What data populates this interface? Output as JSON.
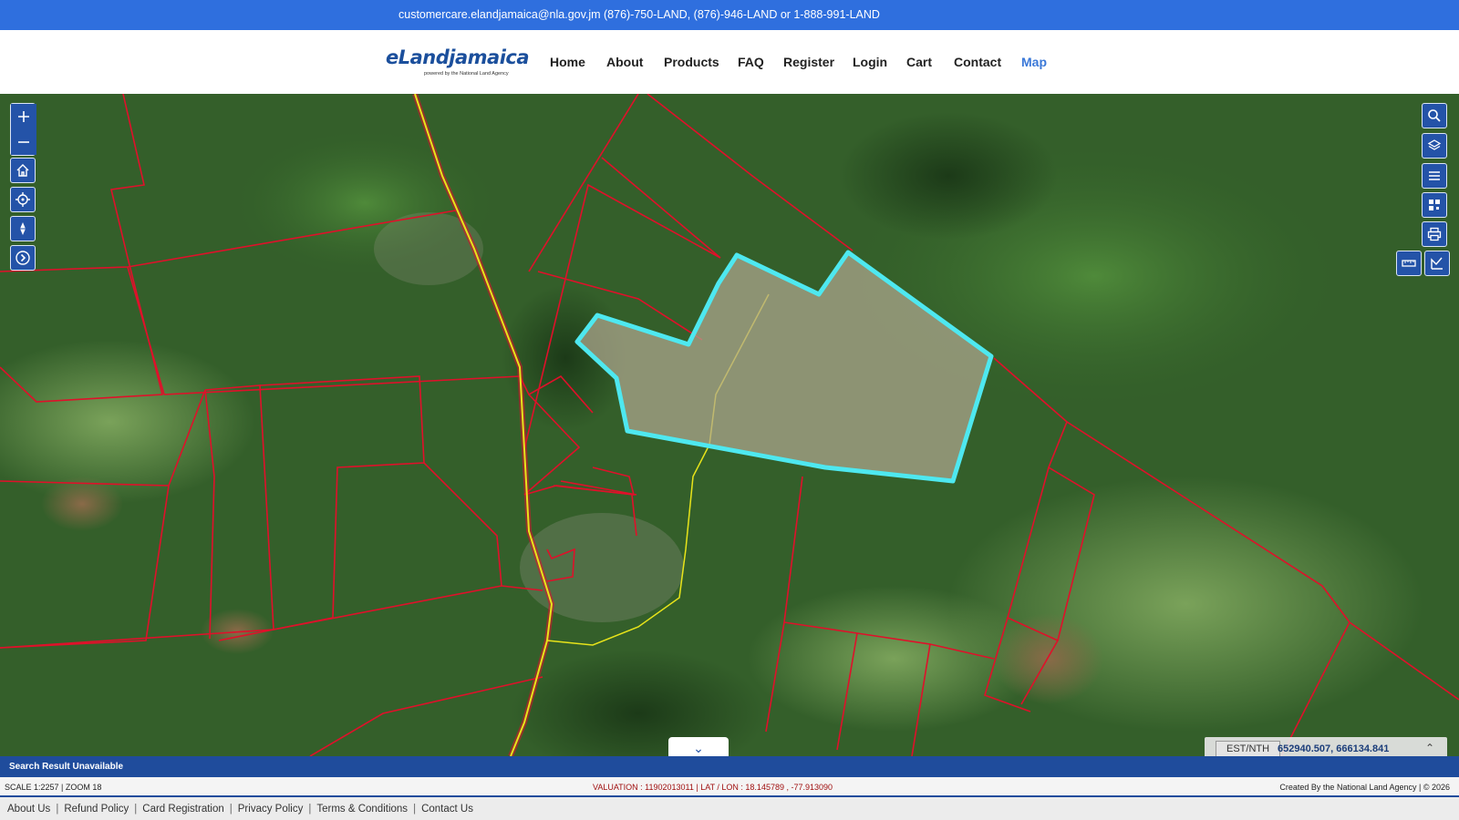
{
  "topbar": {
    "email": "customercare.elandjamaica@nla.gov.jm",
    "phones": "(876)-750-LAND, (876)-946-LAND or 1-888-991-LAND"
  },
  "logo": {
    "brand": "eLandjamaica",
    "tagline": "powered by the National Land Agency"
  },
  "nav": {
    "items": [
      {
        "label": "Home"
      },
      {
        "label": "About"
      },
      {
        "label": "Products"
      },
      {
        "label": "FAQ"
      },
      {
        "label": "Register"
      },
      {
        "label": "Login"
      },
      {
        "label": "Cart"
      },
      {
        "label": "Contact"
      },
      {
        "label": "Map"
      }
    ],
    "active": "Map"
  },
  "map": {
    "left_controls": [
      "zoom-in-icon",
      "zoom-out-icon",
      "home-icon",
      "locate-icon",
      "compass-icon",
      "next-icon"
    ],
    "right_controls": [
      "search-icon",
      "layers-icon",
      "list-icon",
      "qr-icon",
      "print-icon",
      "measure-icon",
      "draw-icon"
    ],
    "coord_label": "EST/NTH",
    "coord_value": "652940.507, 666134.841",
    "colors": {
      "parcel_lines": "#e0102a",
      "selected_parcel": "#4ee8f0",
      "road": "#e8e41a"
    }
  },
  "search_bar": {
    "text": "Search Result Unavailable"
  },
  "status": {
    "scale_zoom": "SCALE 1:2257  |   ZOOM 18",
    "valuation_latlon": "VALUATION : 11902013011 | LAT / LON : 18.145789 , -77.913090",
    "credit": "Created By the National Land Agency   |  © 2026"
  },
  "footer": {
    "links": [
      "About Us",
      "Refund Policy",
      "Card Registration",
      "Privacy Policy",
      "Terms & Conditions",
      "Contact Us"
    ]
  }
}
